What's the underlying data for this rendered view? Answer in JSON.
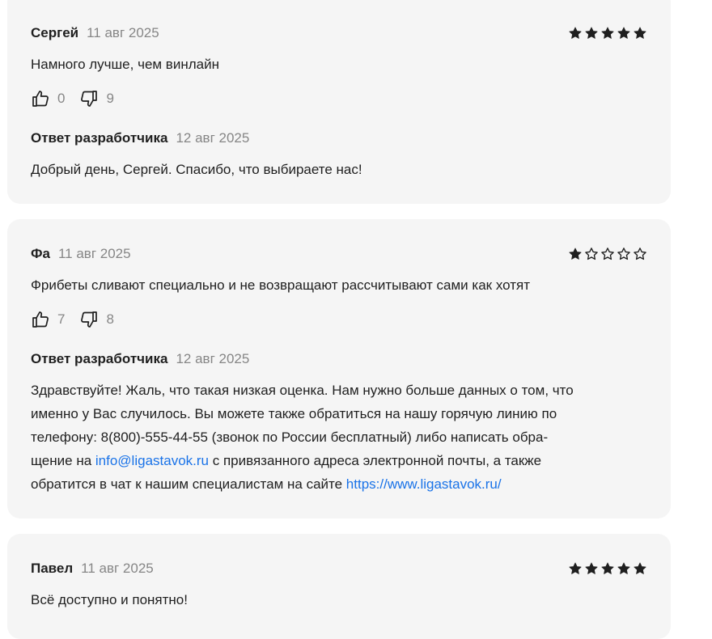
{
  "reviews": [
    {
      "author": "Сергей",
      "date": "11 авг 2025",
      "rating": 5,
      "text": "Намного лучше, чем винлайн",
      "likes": "0",
      "dislikes": "9",
      "reply": {
        "title": "Ответ разработчика",
        "date": "12 авг 2025",
        "text": "Добрый день, Сергей. Спасибо, что выбираете нас!"
      }
    },
    {
      "author": "Фа",
      "date": "11 авг 2025",
      "rating": 1,
      "text": "Фрибеты сливают специально и не возвращают рассчитывают сами как хотят",
      "likes": "7",
      "dislikes": "8",
      "reply": {
        "title": "Ответ разработчика",
        "date": "12 авг 2025",
        "line1": "Здравствуйте! Жаль, что такая низкая оценка. Нам нужно больше данных о том, что",
        "line2": "именно у Вас случилось. Вы можете также обратиться на нашу горячую линию по",
        "line3": "телефону: 8(800)-555-44-55 (звонок по России бесплатный) либо написать обра-",
        "line4_before": "щение на ",
        "email_link": "info@ligastavok.ru",
        "line4_after": " с привязанного адреса электронной почты, а также",
        "line5_before": "обратится в чат к нашим специалистам на сайте ",
        "site_link": "https://www.ligastavok.ru/"
      }
    },
    {
      "author": "Павел",
      "date": "11 авг 2025",
      "rating": 5,
      "text": "Всё доступно и понятно!"
    }
  ],
  "colors": {
    "card_bg": "#f5f5f5",
    "text": "#1f1f1f",
    "muted": "#868686",
    "link": "#1a73e8",
    "star": "#1f1f1f"
  }
}
